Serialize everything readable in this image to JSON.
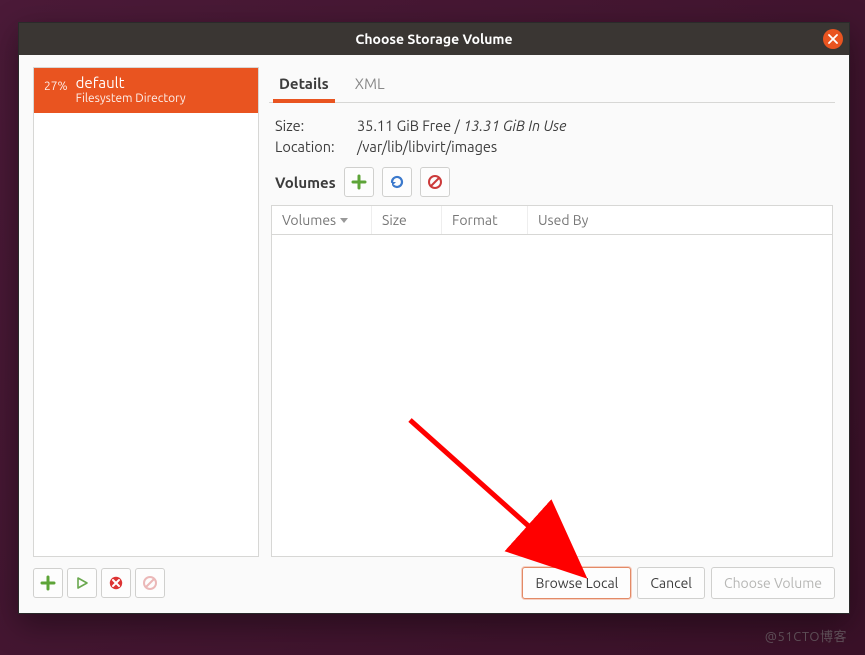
{
  "window": {
    "title": "Choose Storage Volume"
  },
  "sidebar": {
    "pools": [
      {
        "usage_pct": "27%",
        "name": "default",
        "subtitle": "Filesystem Directory"
      }
    ]
  },
  "tabs": {
    "details": "Details",
    "xml": "XML",
    "active": "details"
  },
  "info": {
    "size_label": "Size:",
    "free_text": "35.11 GiB Free",
    "sep": " / ",
    "used_text": "13.31 GiB In Use",
    "location_label": "Location:",
    "location_value": "/var/lib/libvirt/images"
  },
  "volumes_section": {
    "label": "Volumes",
    "columns": {
      "volumes": "Volumes",
      "size": "Size",
      "format": "Format",
      "used_by": "Used By"
    },
    "rows": []
  },
  "buttons": {
    "browse_local": "Browse Local",
    "cancel": "Cancel",
    "choose_volume": "Choose Volume"
  },
  "icons": {
    "close": "close-icon",
    "plus": "plus-icon",
    "play": "play-icon",
    "error": "error-x-icon",
    "forbid": "no-entry-icon",
    "refresh": "refresh-icon"
  },
  "watermark": "@51CTO博客"
}
